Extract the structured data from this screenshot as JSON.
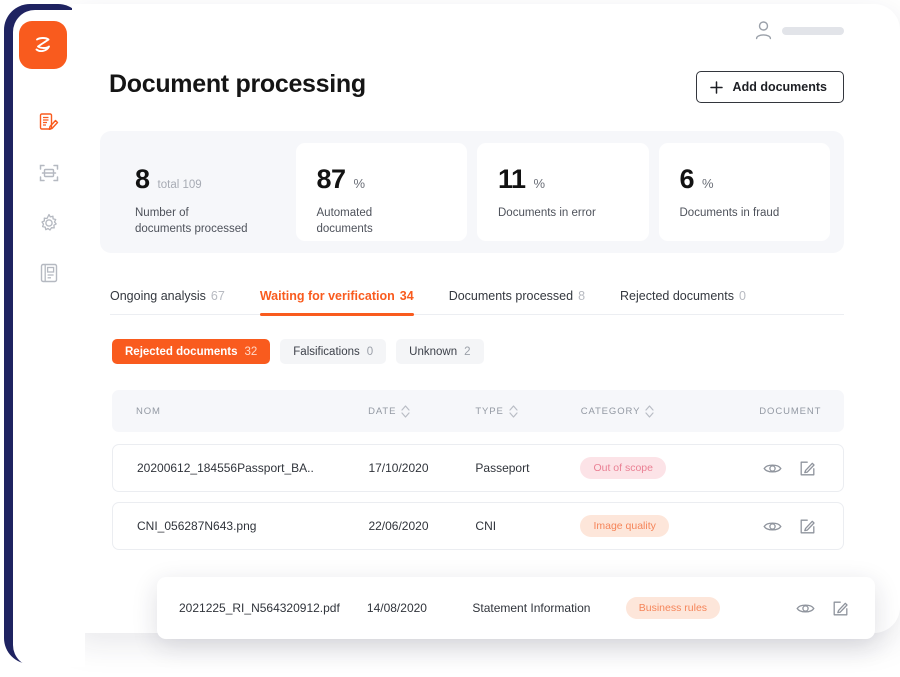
{
  "brand": {
    "logo_glyph": "z-logo-icon",
    "accent": "#f95b1e",
    "navy": "#1f2361"
  },
  "sidebar": {
    "items": [
      {
        "name": "document-edit",
        "label": "Document processing",
        "active": true
      },
      {
        "name": "scan",
        "label": "Scan",
        "active": false
      },
      {
        "name": "settings",
        "label": "Settings",
        "active": false
      },
      {
        "name": "reports",
        "label": "Reports",
        "active": false
      }
    ]
  },
  "header": {
    "title": "Document processing",
    "add_button": "Add documents",
    "add_icon": "plus-icon",
    "user_icon": "user-avatar-icon"
  },
  "stats": [
    {
      "value": "8",
      "unit": "total 109",
      "unit_muted": true,
      "label": "Number of\ndocuments processed",
      "card": false
    },
    {
      "value": "87",
      "unit": "%",
      "unit_muted": false,
      "label": "Automated\ndocuments",
      "card": true
    },
    {
      "value": "11",
      "unit": "%",
      "unit_muted": false,
      "label": "Documents in error",
      "card": true
    },
    {
      "value": "6",
      "unit": "%",
      "unit_muted": false,
      "label": "Documents in fraud",
      "card": true
    }
  ],
  "tabs": [
    {
      "label": "Ongoing analysis",
      "count": "67",
      "active": false
    },
    {
      "label": "Waiting for verification",
      "count": "34",
      "active": true
    },
    {
      "label": "Documents processed",
      "count": "8",
      "active": false
    },
    {
      "label": "Rejected documents",
      "count": "0",
      "active": false
    }
  ],
  "pills": [
    {
      "label": "Rejected documents",
      "count": "32",
      "active": true
    },
    {
      "label": "Falsifications",
      "count": "0",
      "active": false
    },
    {
      "label": "Unknown",
      "count": "2",
      "active": false
    }
  ],
  "table": {
    "headers": {
      "nom": "NOM",
      "date": "DATE",
      "type": "TYPE",
      "category": "CATEGORY",
      "document": "DOCUMENT"
    },
    "rows": [
      {
        "nom": "20200612_184556Passport_BA..",
        "date": "17/10/2020",
        "type": "Passeport",
        "category": "Out of scope",
        "category_color": "pink"
      },
      {
        "nom": "CNI_056287N643.png",
        "date": "22/06/2020",
        "type": "CNI",
        "category": "Image quality",
        "category_color": "orange"
      },
      {
        "nom": "2021225_RI_N564320912.pdf",
        "date": "14/08/2020",
        "type": "Statement Information",
        "category": "Business rules",
        "category_color": "orange"
      }
    ],
    "actions": {
      "view": "eye-icon",
      "edit": "edit-pencil-icon"
    }
  }
}
